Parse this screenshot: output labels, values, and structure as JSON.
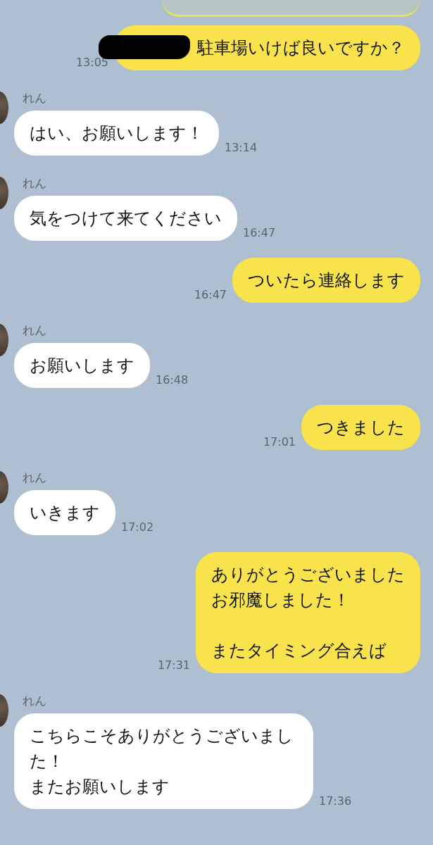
{
  "faded_top": {
    "kind": "outgoing"
  },
  "messages": [
    {
      "kind": "out",
      "redacted": true,
      "paragraphs": [
        [
          "駐車場いけば良いですか？"
        ]
      ],
      "time": "13:05"
    },
    {
      "kind": "in",
      "sender": "れん",
      "paragraphs": [
        [
          "はい、お願いします！"
        ]
      ],
      "time": "13:14"
    },
    {
      "kind": "in",
      "sender": "れん",
      "paragraphs": [
        [
          "気をつけて来てください"
        ]
      ],
      "time": "16:47"
    },
    {
      "kind": "out",
      "redacted": false,
      "paragraphs": [
        [
          "ついたら連絡します"
        ]
      ],
      "time": "16:47"
    },
    {
      "kind": "in",
      "sender": "れん",
      "paragraphs": [
        [
          "お願いします"
        ]
      ],
      "time": "16:48"
    },
    {
      "kind": "out",
      "redacted": false,
      "paragraphs": [
        [
          "つきました"
        ]
      ],
      "time": "17:01"
    },
    {
      "kind": "in",
      "sender": "れん",
      "paragraphs": [
        [
          "いきます"
        ]
      ],
      "time": "17:02"
    },
    {
      "kind": "out",
      "redacted": false,
      "paragraphs": [
        [
          "ありがとうございました",
          "お邪魔しました！"
        ],
        [
          "またタイミング合えば"
        ]
      ],
      "time": "17:31"
    },
    {
      "kind": "in",
      "sender": "れん",
      "paragraphs": [
        [
          "こちらこそありがとうございました！",
          "またお願いします"
        ]
      ],
      "time": "17:36"
    }
  ]
}
